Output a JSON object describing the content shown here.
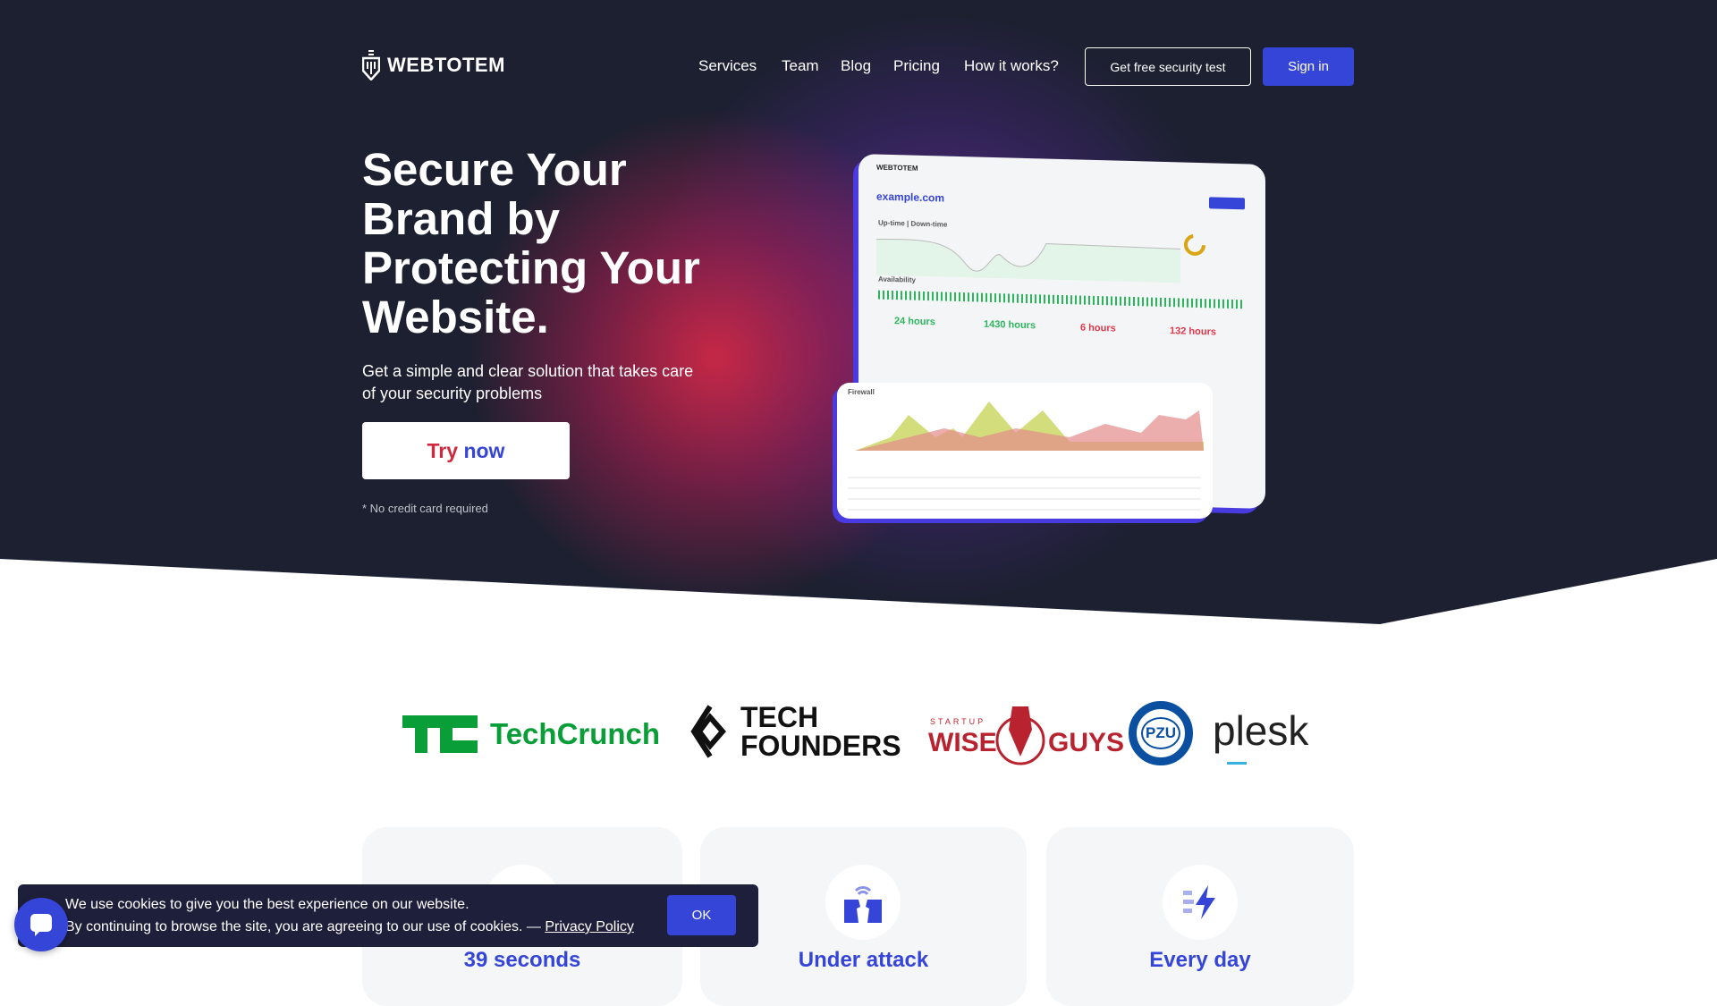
{
  "brand": {
    "name": "WEBTOTEM"
  },
  "nav": {
    "items": [
      "Services",
      "Team",
      "Blog",
      "Pricing",
      "How it works?"
    ],
    "cta_test": "Get free security test",
    "sign_in": "Sign in"
  },
  "hero": {
    "title": "Secure Your Brand by Protecting Your Website.",
    "subtitle": "Get a simple and clear solution that takes care of your security problems",
    "try_word1": "Try",
    "try_word2": "now",
    "note": "* No credit card required"
  },
  "mockup": {
    "brand": "WEBTOTEM",
    "domain": "example.com",
    "section1": "Up-time | Down-time",
    "section2": "Availability",
    "stats": [
      {
        "value": "24 hours",
        "color": "#2db55d"
      },
      {
        "value": "1430 hours",
        "color": "#2db55d"
      },
      {
        "value": "6 hours",
        "color": "#e0364a"
      },
      {
        "value": "132 hours",
        "color": "#e0364a"
      }
    ],
    "firewall": "Firewall"
  },
  "partners": [
    "TechCrunch",
    "TECH FOUNDERS",
    "STARTUP",
    "WISE",
    "GUYS",
    "PZU",
    "plesk"
  ],
  "cards": [
    {
      "title": "39 seconds",
      "icon": "clock-icon"
    },
    {
      "title": "Under attack",
      "icon": "heads-signal-icon"
    },
    {
      "title": "Every day",
      "icon": "lightning-icon"
    }
  ],
  "cookie": {
    "line1": "We use cookies to give you the best experience on our website.",
    "line2": "By continuing to browse the site, you are agreeing to our use of cookies. — ",
    "link": "Privacy Policy",
    "ok": "OK"
  },
  "colors": {
    "accent": "#3545d8",
    "dark": "#1c2030",
    "red": "#d0283f"
  }
}
